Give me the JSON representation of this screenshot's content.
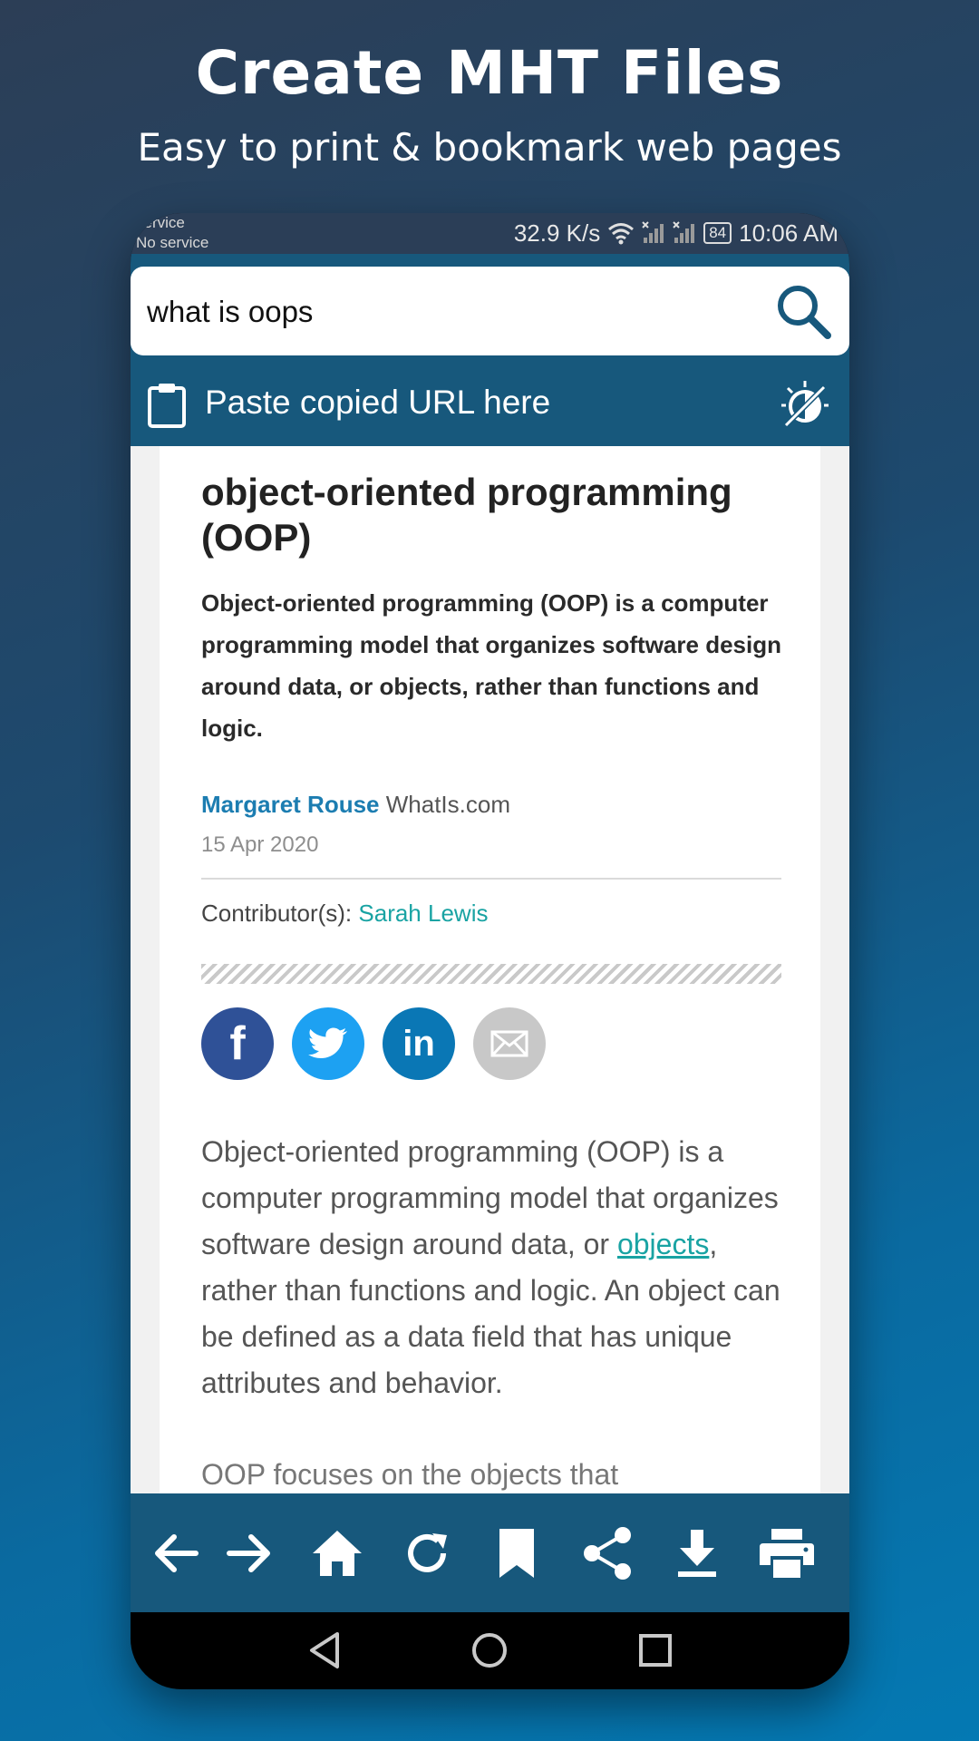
{
  "promo": {
    "title": "Create MHT Files",
    "subtitle": "Easy to print & bookmark web pages"
  },
  "status_bar": {
    "carrier_line1": "service",
    "carrier_line2": "No service",
    "speed": "32.9 K/s",
    "battery": "84",
    "time": "10:06 AM"
  },
  "search": {
    "value": "what is oops"
  },
  "paste": {
    "label": "Paste copied URL here"
  },
  "article": {
    "title": "object-oriented programming (OOP)",
    "summary": "Object-oriented programming (OOP) is a computer programming model that organizes software design around data, or objects, rather than functions and logic.",
    "author": "Margaret Rouse",
    "site": "WhatIs.com",
    "date": "15 Apr 2020",
    "contributor_label": "Contributor(s):",
    "contributor_name": "Sarah Lewis",
    "body_start": "Object-oriented programming (OOP) is a computer programming model that organizes software design around data, or ",
    "body_link": "objects",
    "body_end": ", rather than functions and logic. An object can be defined as a data field that has unique attributes and behavior.",
    "body_cut": "OOP focuses on the objects that"
  },
  "share": {
    "facebook": "f",
    "linkedin": "in"
  },
  "icons": {
    "search": "search-icon",
    "clipboard": "clipboard-icon",
    "theme": "theme-toggle-icon",
    "back": "arrow-left-icon",
    "forward": "arrow-right-icon",
    "home": "home-icon",
    "reload": "reload-icon",
    "bookmark": "bookmark-icon",
    "share": "share-icon",
    "download": "download-icon",
    "print": "print-icon"
  },
  "colors": {
    "app_bar": "#17587c",
    "status_bar": "#2b3e57",
    "link": "#1c7db1",
    "teal": "#19a3a3",
    "facebook": "#2f5197",
    "twitter": "#1da1f2",
    "linkedin": "#0a77b5",
    "email": "#c8c8c8"
  }
}
